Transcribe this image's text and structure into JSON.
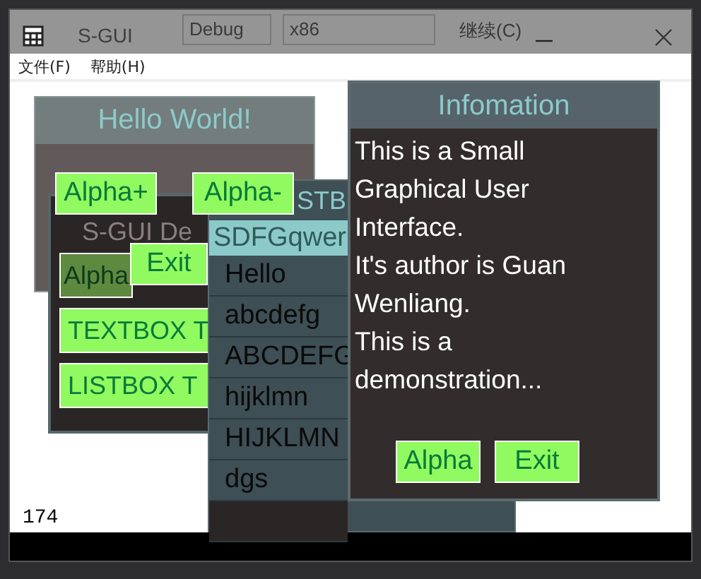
{
  "ide_toolbar": {
    "configuration": "Debug",
    "platform": "x86",
    "continue": "继续(C)"
  },
  "window": {
    "title": "S-GUI",
    "menu": [
      "文件(F)",
      "帮助(H)"
    ]
  },
  "canvas": {
    "counter": "174"
  },
  "sgui_window": {
    "title": "S-GUI De",
    "buttons": [
      "Alpha",
      "TEXTBOX T",
      "LISTBOX T"
    ]
  },
  "listbox_window": {
    "title": "STB",
    "textbox": "SDFGqwer",
    "items": [
      "Hello",
      "abcdefg",
      "ABCDEFG",
      "hijklmn",
      "HIJKLMN",
      "dgs"
    ]
  },
  "hello_window": {
    "title": "Hello World!",
    "buttons": [
      "Alpha+",
      "Alpha-",
      "Exit"
    ]
  },
  "info_window": {
    "title": "Infomation",
    "lines": [
      "This is a Small",
      "Graphical User",
      "Interface.",
      "It's author is Guan",
      "Wenliang.",
      "This is a",
      "demonstration..."
    ],
    "buttons": [
      "Alpha",
      "Exit"
    ]
  }
}
